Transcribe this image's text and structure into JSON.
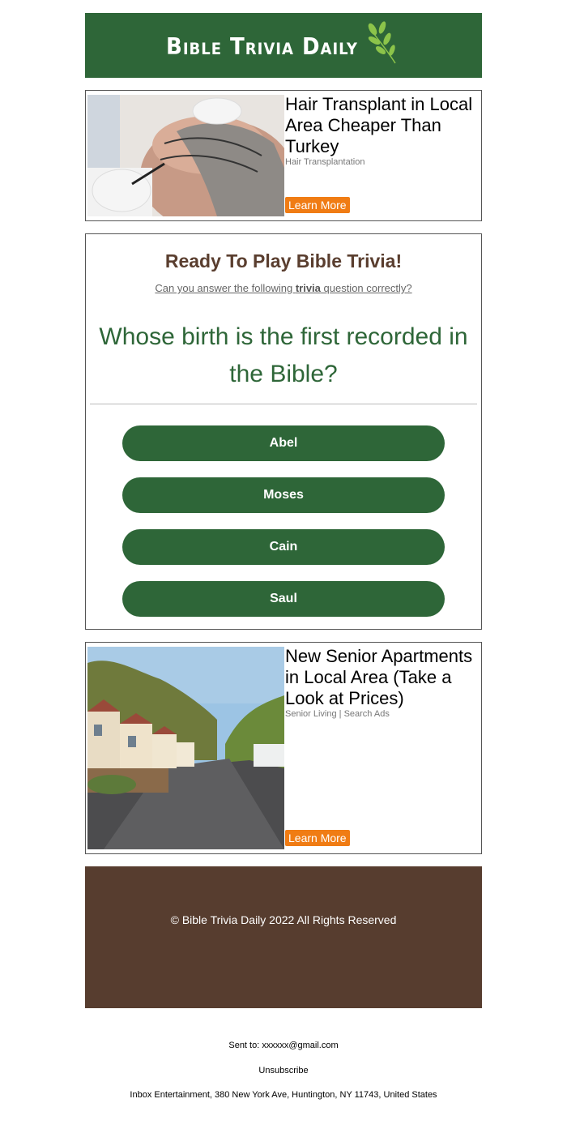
{
  "header": {
    "logo_text": "Bible Trivia Daily",
    "brand_color": "#2e6638"
  },
  "ads": [
    {
      "title": "Hair Transplant in Local Area Cheaper Than Turkey",
      "source": "Hair Transplantation",
      "button": "Learn More",
      "image": "hair-transplant-photo"
    },
    {
      "title": "New Senior Apartments in Local Area (Take a Look at Prices)",
      "source": "Senior Living | Search Ads",
      "button": "Learn More",
      "image": "senior-homes-street-photo"
    }
  ],
  "trivia": {
    "title": "Ready To Play Bible Trivia!",
    "subtitle_before": "Can you answer the following ",
    "subtitle_bold": "trivia",
    "subtitle_after": " question correctly?",
    "question": "Whose birth is the first recorded in the Bible?",
    "answers": [
      "Abel",
      "Moses",
      "Cain",
      "Saul"
    ]
  },
  "footer": {
    "copyright": "© Bible Trivia Daily 2022 All Rights Reserved",
    "color": "#573d2f"
  },
  "meta": {
    "sent_to": "Sent to: xxxxxx@gmail.com",
    "unsubscribe": "Unsubscribe",
    "address": "Inbox Entertainment, 380 New York Ave, Huntington, NY 11743, United States"
  }
}
